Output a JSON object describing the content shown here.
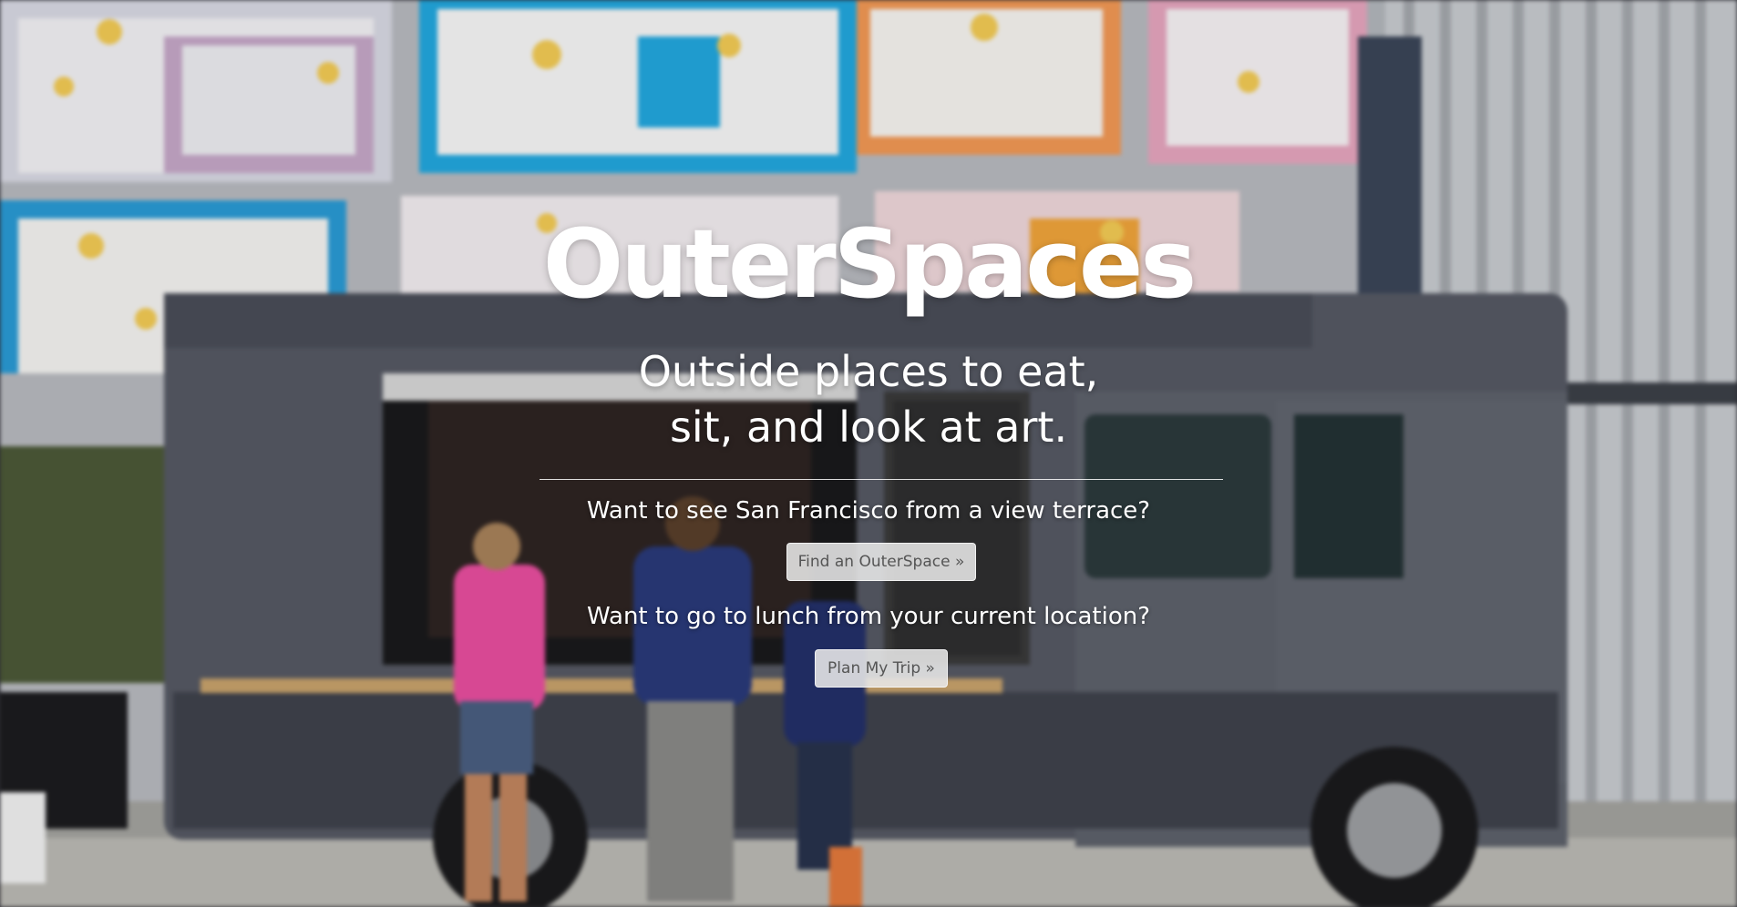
{
  "hero": {
    "brand": "OuterSpaces",
    "tagline_line1": "Outside places to eat,",
    "tagline_line2": "sit, and look at art."
  },
  "sections": [
    {
      "question": "Want to see San Francisco from a view terrace?",
      "button_label": "Find an OuterSpace »"
    },
    {
      "question": "Want to go to lunch from your current location?",
      "button_label": "Plan My Trip »"
    }
  ]
}
